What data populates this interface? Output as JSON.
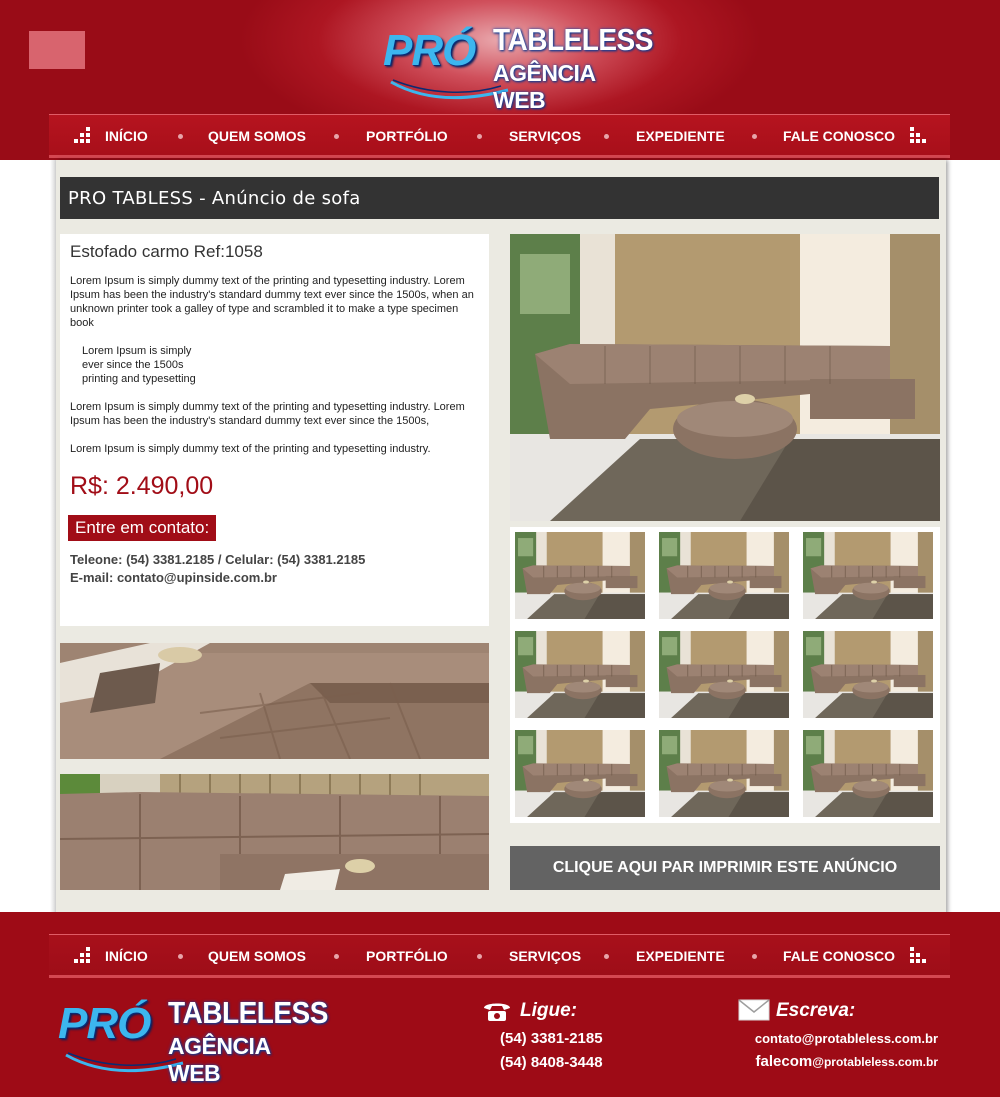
{
  "brand": {
    "pro": "PRÓ",
    "tableless": "TABLELESS",
    "agencia": "AGÊNCIA WEB"
  },
  "nav": {
    "items": [
      "INÍCIO",
      "QUEM SOMOS",
      "PORTFÓLIO",
      "SERVIÇOS",
      "EXPEDIENTE",
      "FALE CONOSCO"
    ]
  },
  "page": {
    "title": "PRO TABLESS - Anúncio de sofa"
  },
  "product": {
    "name": "Estofado carmo Ref:1058",
    "paragraph1": "Lorem Ipsum is simply dummy text of the printing and typesetting industry. Lorem Ipsum has been the industry's standard dummy text ever since the 1500s, when an unknown printer took a galley of type and scrambled it to make a type specimen book",
    "list": [
      "Lorem Ipsum is simply",
      "ever since the 1500s",
      "printing and typesetting"
    ],
    "paragraph2": "Lorem Ipsum is simply dummy text of the printing and typesetting industry. Lorem Ipsum has been the industry's standard dummy text ever since the 1500s,",
    "paragraph3": "Lorem Ipsum is simply dummy text of the printing and typesetting industry.",
    "price": "R$: 2.490,00",
    "contact_label": "Entre em contato:",
    "phones": "Teleone: (54) 3381.2185 / Celular: (54) 3381.2185",
    "email": "E-mail: contato@upinside.com.br"
  },
  "print_button": "CLIQUE AQUI PAR IMPRIMIR ESTE ANÚNCIO",
  "footer": {
    "call_label": "Ligue:",
    "phone1": "(54) 3381-2185",
    "phone2": "(54) 8408-3448",
    "write_label": "Escreva:",
    "email1": "contato@protableless.com.br",
    "email2_user": "falecom",
    "email2_domain": "@protableless.com.br"
  },
  "icons": {
    "phone": "phone-icon",
    "mail": "envelope-icon",
    "nav_deco": "pixel-steps-icon"
  },
  "colors": {
    "brand_red": "#a10d17",
    "header_red": "#ad1622",
    "logo_blue": "#3cb6ee",
    "panel_bg": "#ebeae2",
    "title_bar": "#333333",
    "print_button": "#636363"
  }
}
